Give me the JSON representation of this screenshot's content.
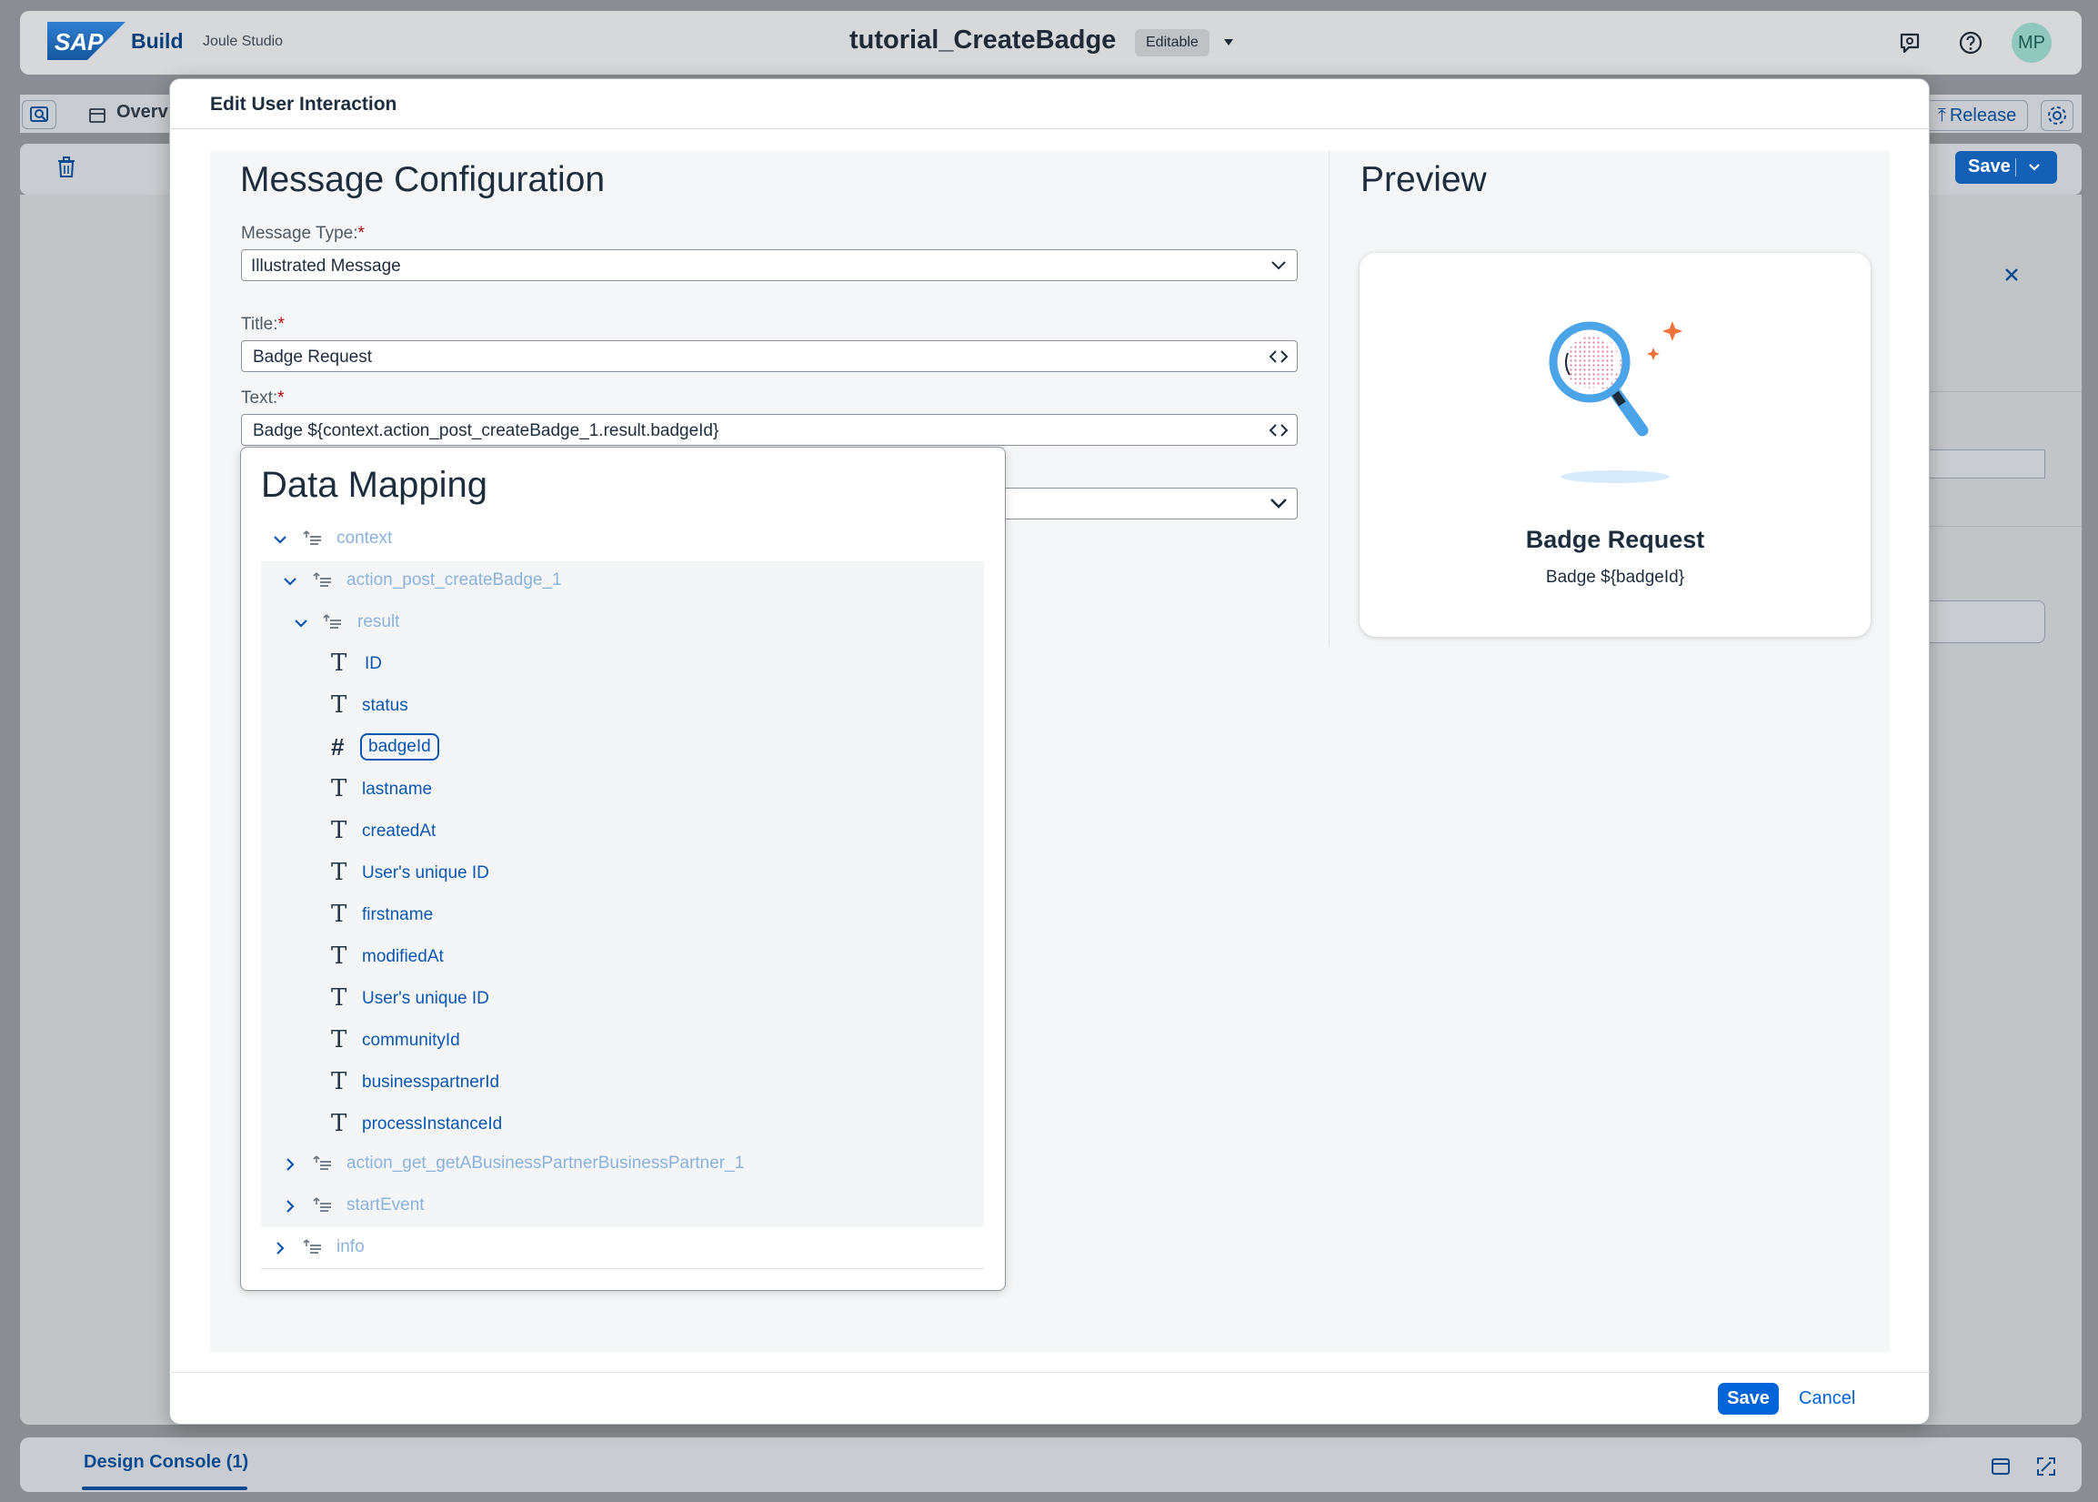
{
  "app": {
    "brand": "SAP",
    "product": "Build",
    "module": "Joule Studio",
    "project_title": "tutorial_CreateBadge",
    "status_badge": "Editable",
    "avatar_initials": "MP"
  },
  "toolbar": {
    "overview_label": "Overv",
    "release_label": "Release",
    "save_label": "Save"
  },
  "dialog": {
    "title": "Edit User Interaction",
    "config_heading": "Message Configuration",
    "preview_heading": "Preview",
    "fields": {
      "message_type_label": "Message Type:",
      "message_type_value": "Illustrated Message",
      "title_label": "Title:",
      "title_value": "Badge Request",
      "text_label": "Text:",
      "text_value": "Badge ${context.action_post_createBadge_1.result.badgeId}",
      "required_mark": "*"
    },
    "preview": {
      "title": "Badge Request",
      "text": "Badge ${badgeId}"
    },
    "footer": {
      "save_label": "Save",
      "cancel_label": "Cancel"
    }
  },
  "data_mapping": {
    "title": "Data Mapping",
    "nodes": [
      {
        "label": "context",
        "kind": "object",
        "expanded": true
      },
      {
        "label": "action_post_createBadge_1",
        "kind": "object",
        "expanded": true
      },
      {
        "label": "result",
        "kind": "object",
        "expanded": true
      },
      {
        "label": "ID",
        "kind": "text",
        "type_glyph": "T"
      },
      {
        "label": "status",
        "kind": "text",
        "type_glyph": "T"
      },
      {
        "label": "badgeId",
        "kind": "number",
        "type_glyph": "#",
        "selected": true
      },
      {
        "label": "lastname",
        "kind": "text",
        "type_glyph": "T"
      },
      {
        "label": "createdAt",
        "kind": "text",
        "type_glyph": "T"
      },
      {
        "label": "User's unique ID",
        "kind": "text",
        "type_glyph": "T"
      },
      {
        "label": "firstname",
        "kind": "text",
        "type_glyph": "T"
      },
      {
        "label": "modifiedAt",
        "kind": "text",
        "type_glyph": "T"
      },
      {
        "label": "User's unique ID",
        "kind": "text",
        "type_glyph": "T"
      },
      {
        "label": "communityId",
        "kind": "text",
        "type_glyph": "T"
      },
      {
        "label": "businesspartnerId",
        "kind": "text",
        "type_glyph": "T"
      },
      {
        "label": "processInstanceId",
        "kind": "text",
        "type_glyph": "T"
      },
      {
        "label": "action_get_getABusinessPartnerBusinessPartner_1",
        "kind": "object",
        "expanded": false
      },
      {
        "label": "startEvent",
        "kind": "object",
        "expanded": false
      },
      {
        "label": "info",
        "kind": "object",
        "expanded": false
      }
    ]
  },
  "console": {
    "tab_label": "Design Console (1)"
  },
  "colors": {
    "accent": "#0064d9",
    "link": "#0a56b0",
    "required": "#aa0808",
    "sparkle": "#f2713a",
    "lens": "#4ba3e8"
  }
}
